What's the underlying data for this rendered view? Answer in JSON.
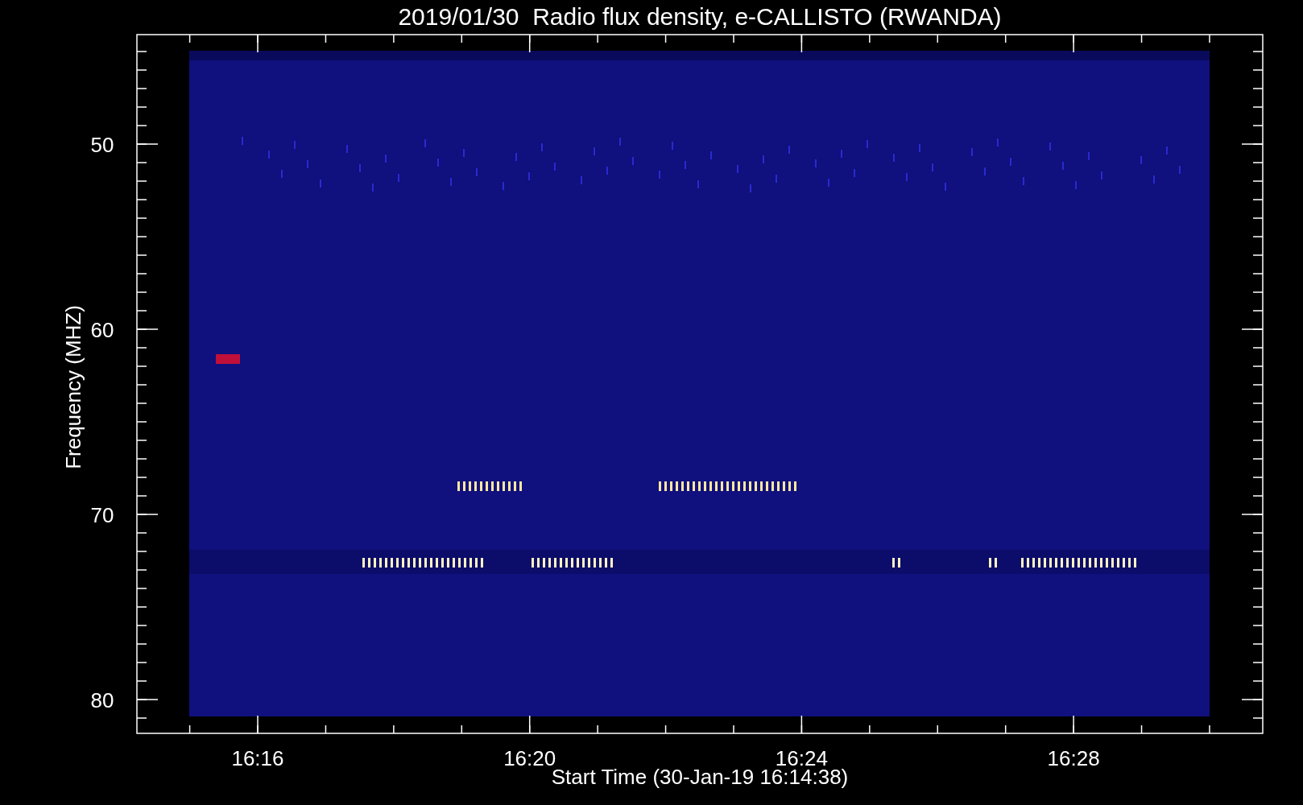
{
  "title": "2019/01/30  Radio flux density, e-CALLISTO (RWANDA)",
  "ylabel": "Frequency (MHZ)",
  "xlabel": "Start Time (30-Jan-19 16:14:38)",
  "xticks": [
    "16:16",
    "16:20",
    "16:24",
    "16:28"
  ],
  "yticks": [
    "50",
    "60",
    "70",
    "80"
  ]
}
